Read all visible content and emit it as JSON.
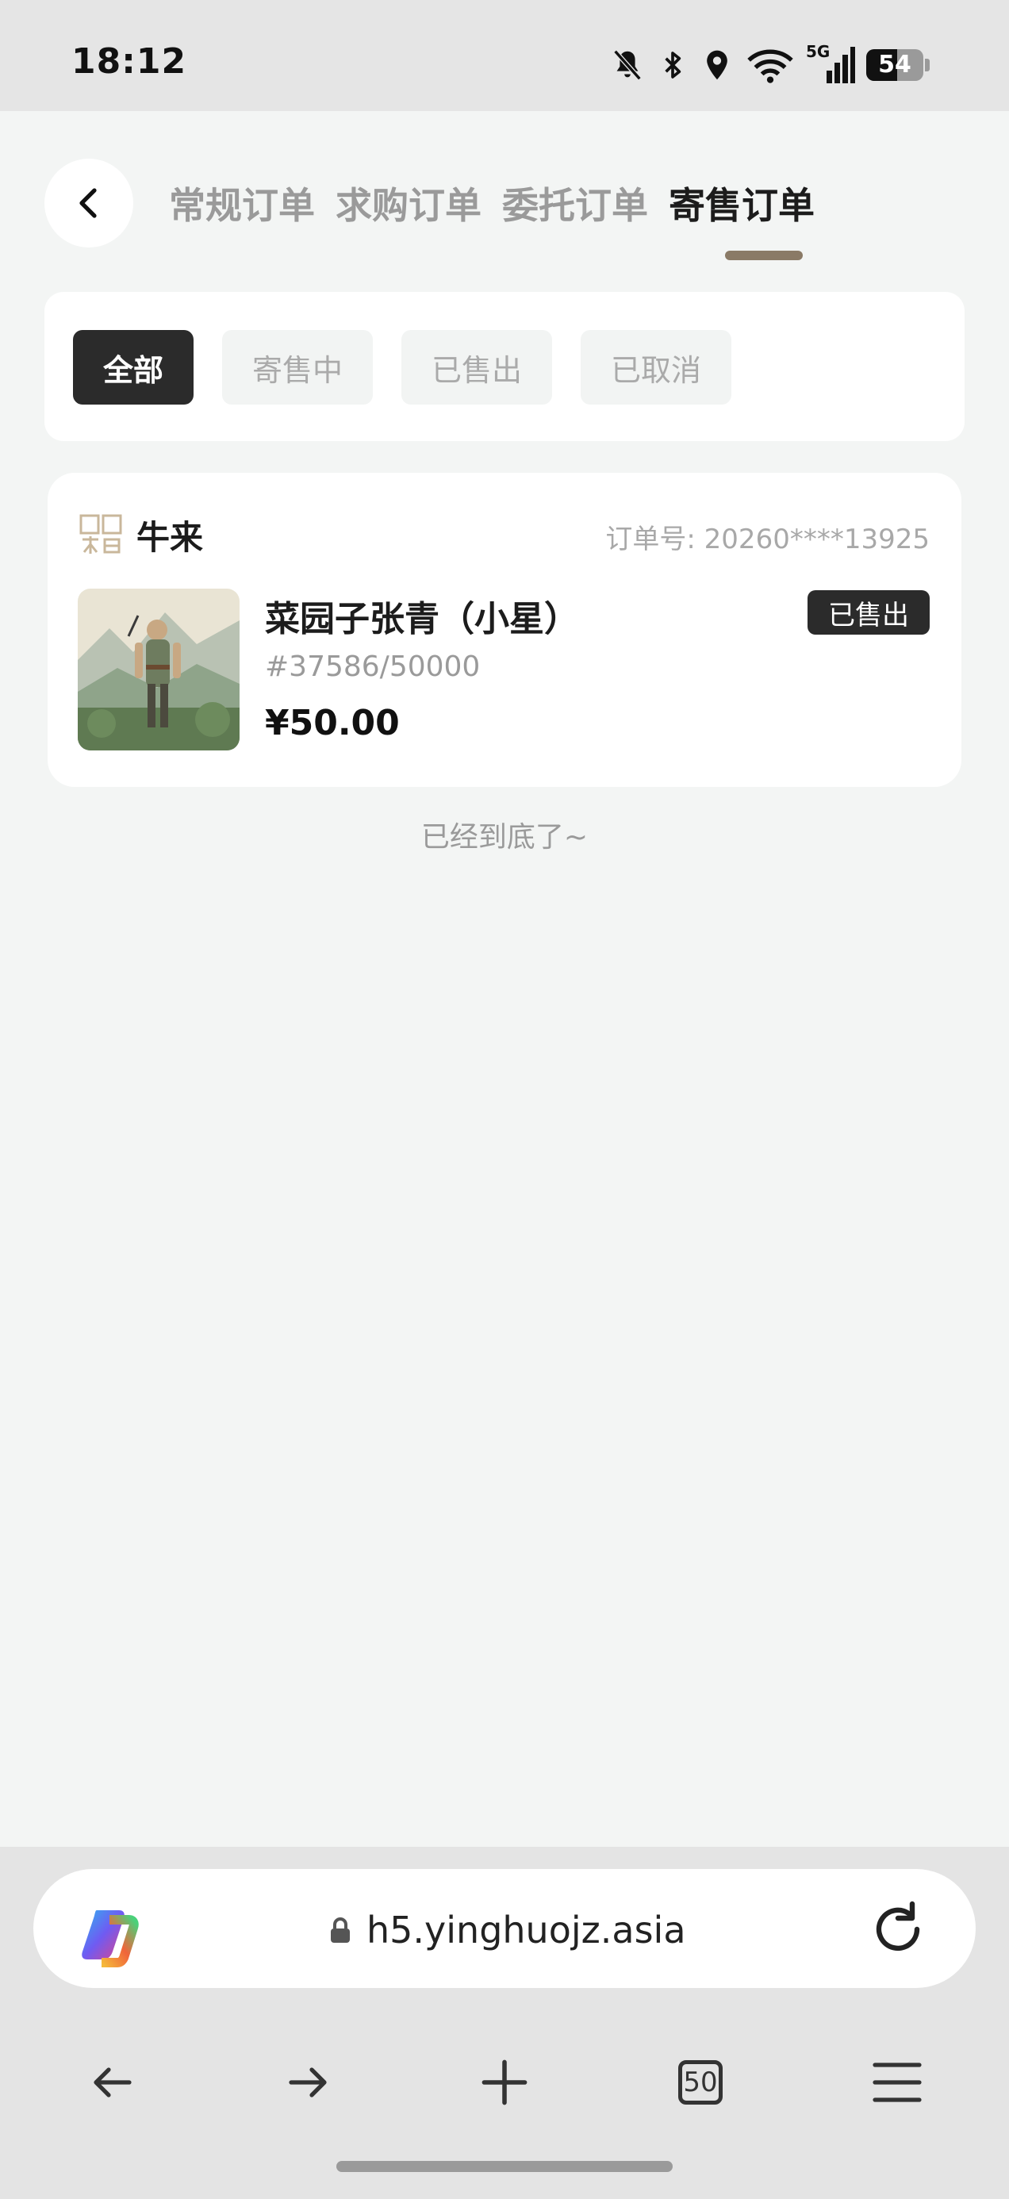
{
  "status_bar": {
    "time": "18:12",
    "network": "5G",
    "battery": "54",
    "battery_level": 0.54,
    "icons": [
      "bell-muted-icon",
      "bluetooth-icon",
      "location-icon",
      "wifi-icon",
      "signal-icon",
      "battery-icon"
    ]
  },
  "header": {
    "back_icon": "chevron-left-icon",
    "tabs": [
      {
        "label": "常规订单",
        "active": false
      },
      {
        "label": "求购订单",
        "active": false
      },
      {
        "label": "委托订单",
        "active": false
      },
      {
        "label": "寄售订单",
        "active": true
      }
    ]
  },
  "filters": [
    {
      "label": "全部",
      "active": true
    },
    {
      "label": "寄售中",
      "active": false
    },
    {
      "label": "已售出",
      "active": false
    },
    {
      "label": "已取消",
      "active": false
    }
  ],
  "orders": [
    {
      "shop_logo_text": "唐门天启",
      "shop_name": "牛来",
      "order_number": "订单号: 20260****13925",
      "title": "菜园子张青（小星）",
      "serial": "#37586/50000",
      "price": "¥50.00",
      "status": "已售出"
    }
  ],
  "end_text": "已经到底了~",
  "browser": {
    "url": "h5.yinghuojz.asia",
    "tabs_count": "50",
    "nav_icons": [
      "arrow-left-icon",
      "arrow-right-icon",
      "plus-icon",
      "tabs-icon",
      "menu-icon"
    ]
  },
  "colors": {
    "page_bg": "#f3f5f4",
    "accent_indicator": "#8a7a66",
    "chip_active": "#2b2b2b",
    "muted_text": "#9a9a9a"
  }
}
